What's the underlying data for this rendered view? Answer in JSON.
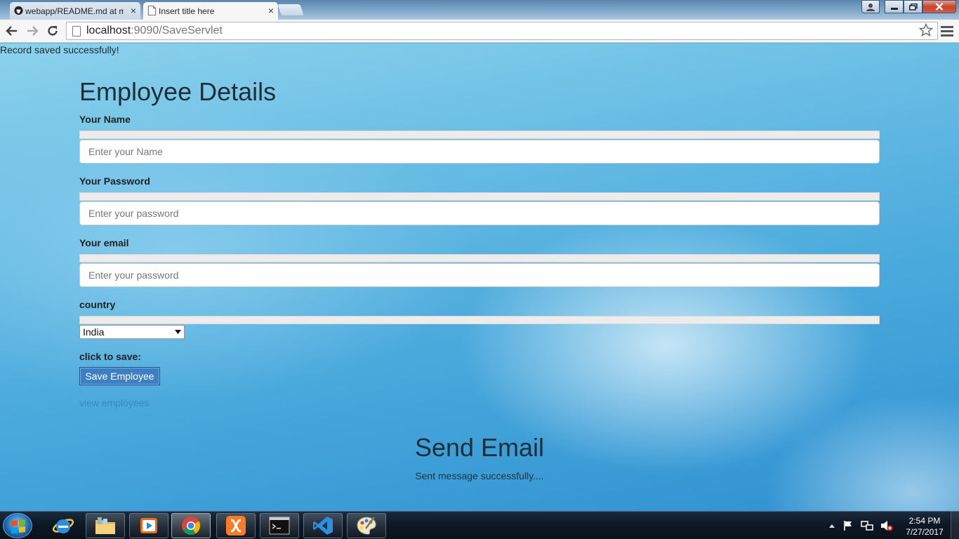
{
  "browser": {
    "tabs": [
      {
        "label": "webapp/README.md at m",
        "active": false
      },
      {
        "label": "Insert title here",
        "active": true
      }
    ],
    "url_host": "localhost",
    "url_rest": ":9090/SaveServlet",
    "close_glyph": "×"
  },
  "page": {
    "record_message": "Record saved successfully!",
    "form_title": "Employee Details",
    "name_label": "Your Name",
    "name_placeholder": "Enter your Name",
    "password_label": "Your Password",
    "password_placeholder": "Enter your password",
    "email_label": "Your email",
    "email_placeholder": "Enter your password",
    "country_label": "country",
    "country_value": "India",
    "save_label": "click to save:",
    "save_button": "Save Employee",
    "view_link": "view employees",
    "email_title": "Send Email",
    "email_message": "Sent message successfully...."
  },
  "taskbar": {
    "time": "2:54 PM",
    "date": "7/27/2017"
  },
  "colors": {
    "button_blue": "#3c7fc5",
    "link_blue": "#3a88c4",
    "close_red": "#c8432e"
  }
}
